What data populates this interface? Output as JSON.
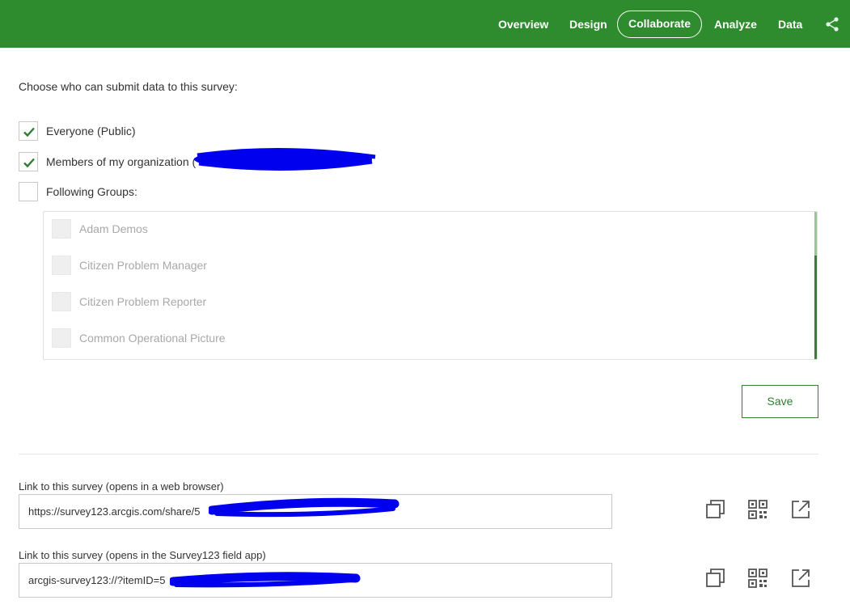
{
  "nav": {
    "items": [
      "Overview",
      "Design",
      "Collaborate",
      "Analyze",
      "Data"
    ],
    "active": "Collaborate"
  },
  "heading": "Choose who can submit data to this survey:",
  "options": [
    {
      "label": "Everyone (Public)",
      "checked": true
    },
    {
      "label": "Members of my organization (",
      "checked": true
    },
    {
      "label": "Following Groups:",
      "checked": false
    }
  ],
  "groups": [
    "Adam Demos",
    "Citizen Problem Manager",
    "Citizen Problem Reporter",
    "Common Operational Picture"
  ],
  "save_label": "Save",
  "links": [
    {
      "label": "Link to this survey (opens in a web browser)",
      "value": "https://survey123.arcgis.com/share/5"
    },
    {
      "label": "Link to this survey (opens in the Survey123 field app)",
      "value": "arcgis-survey123://?itemID=5"
    }
  ],
  "colors": {
    "header": "#2e8b2e",
    "check": "#2e7d32",
    "redaction": "#0000ee"
  },
  "icons": {
    "share": "share-icon",
    "copy": "copy-icon",
    "qr": "qr-code-icon",
    "open": "open-external-icon",
    "check": "check-icon"
  }
}
